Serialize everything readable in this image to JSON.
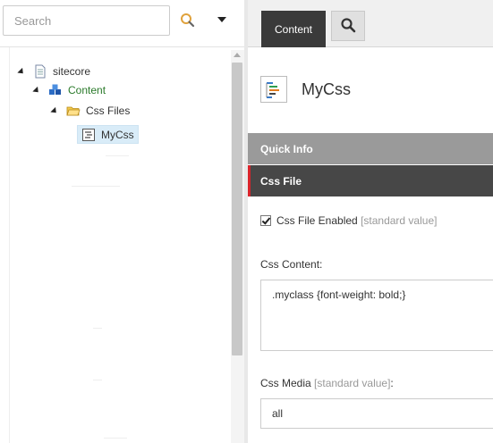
{
  "search": {
    "placeholder": "Search"
  },
  "tree": {
    "nodes": [
      {
        "label": "sitecore",
        "icon": "document-icon"
      },
      {
        "label": "Content",
        "icon": "content-cubes-icon"
      },
      {
        "label": "Css Files",
        "icon": "folder-icon"
      },
      {
        "label": "MyCss",
        "icon": "css-file-icon",
        "selected": true
      }
    ]
  },
  "tabs": {
    "content_label": "Content",
    "search_icon": "search-icon"
  },
  "item": {
    "title": "MyCss",
    "icon": "css-file-icon"
  },
  "sections": {
    "quick_info": "Quick Info",
    "css_file": "Css File"
  },
  "fields": {
    "css_file_enabled": {
      "label": "Css File Enabled",
      "suffix": "[standard value]",
      "checked": true
    },
    "css_content": {
      "label": "Css Content:",
      "value": ".myclass {font-weight: bold;}"
    },
    "css_media": {
      "label": "Css Media",
      "suffix": "[standard value]",
      "colon": ":",
      "value": "all"
    }
  },
  "colors": {
    "accent_red": "#d9242b",
    "tab_dark": "#3a3a3a",
    "content_green": "#2a7a2a"
  }
}
